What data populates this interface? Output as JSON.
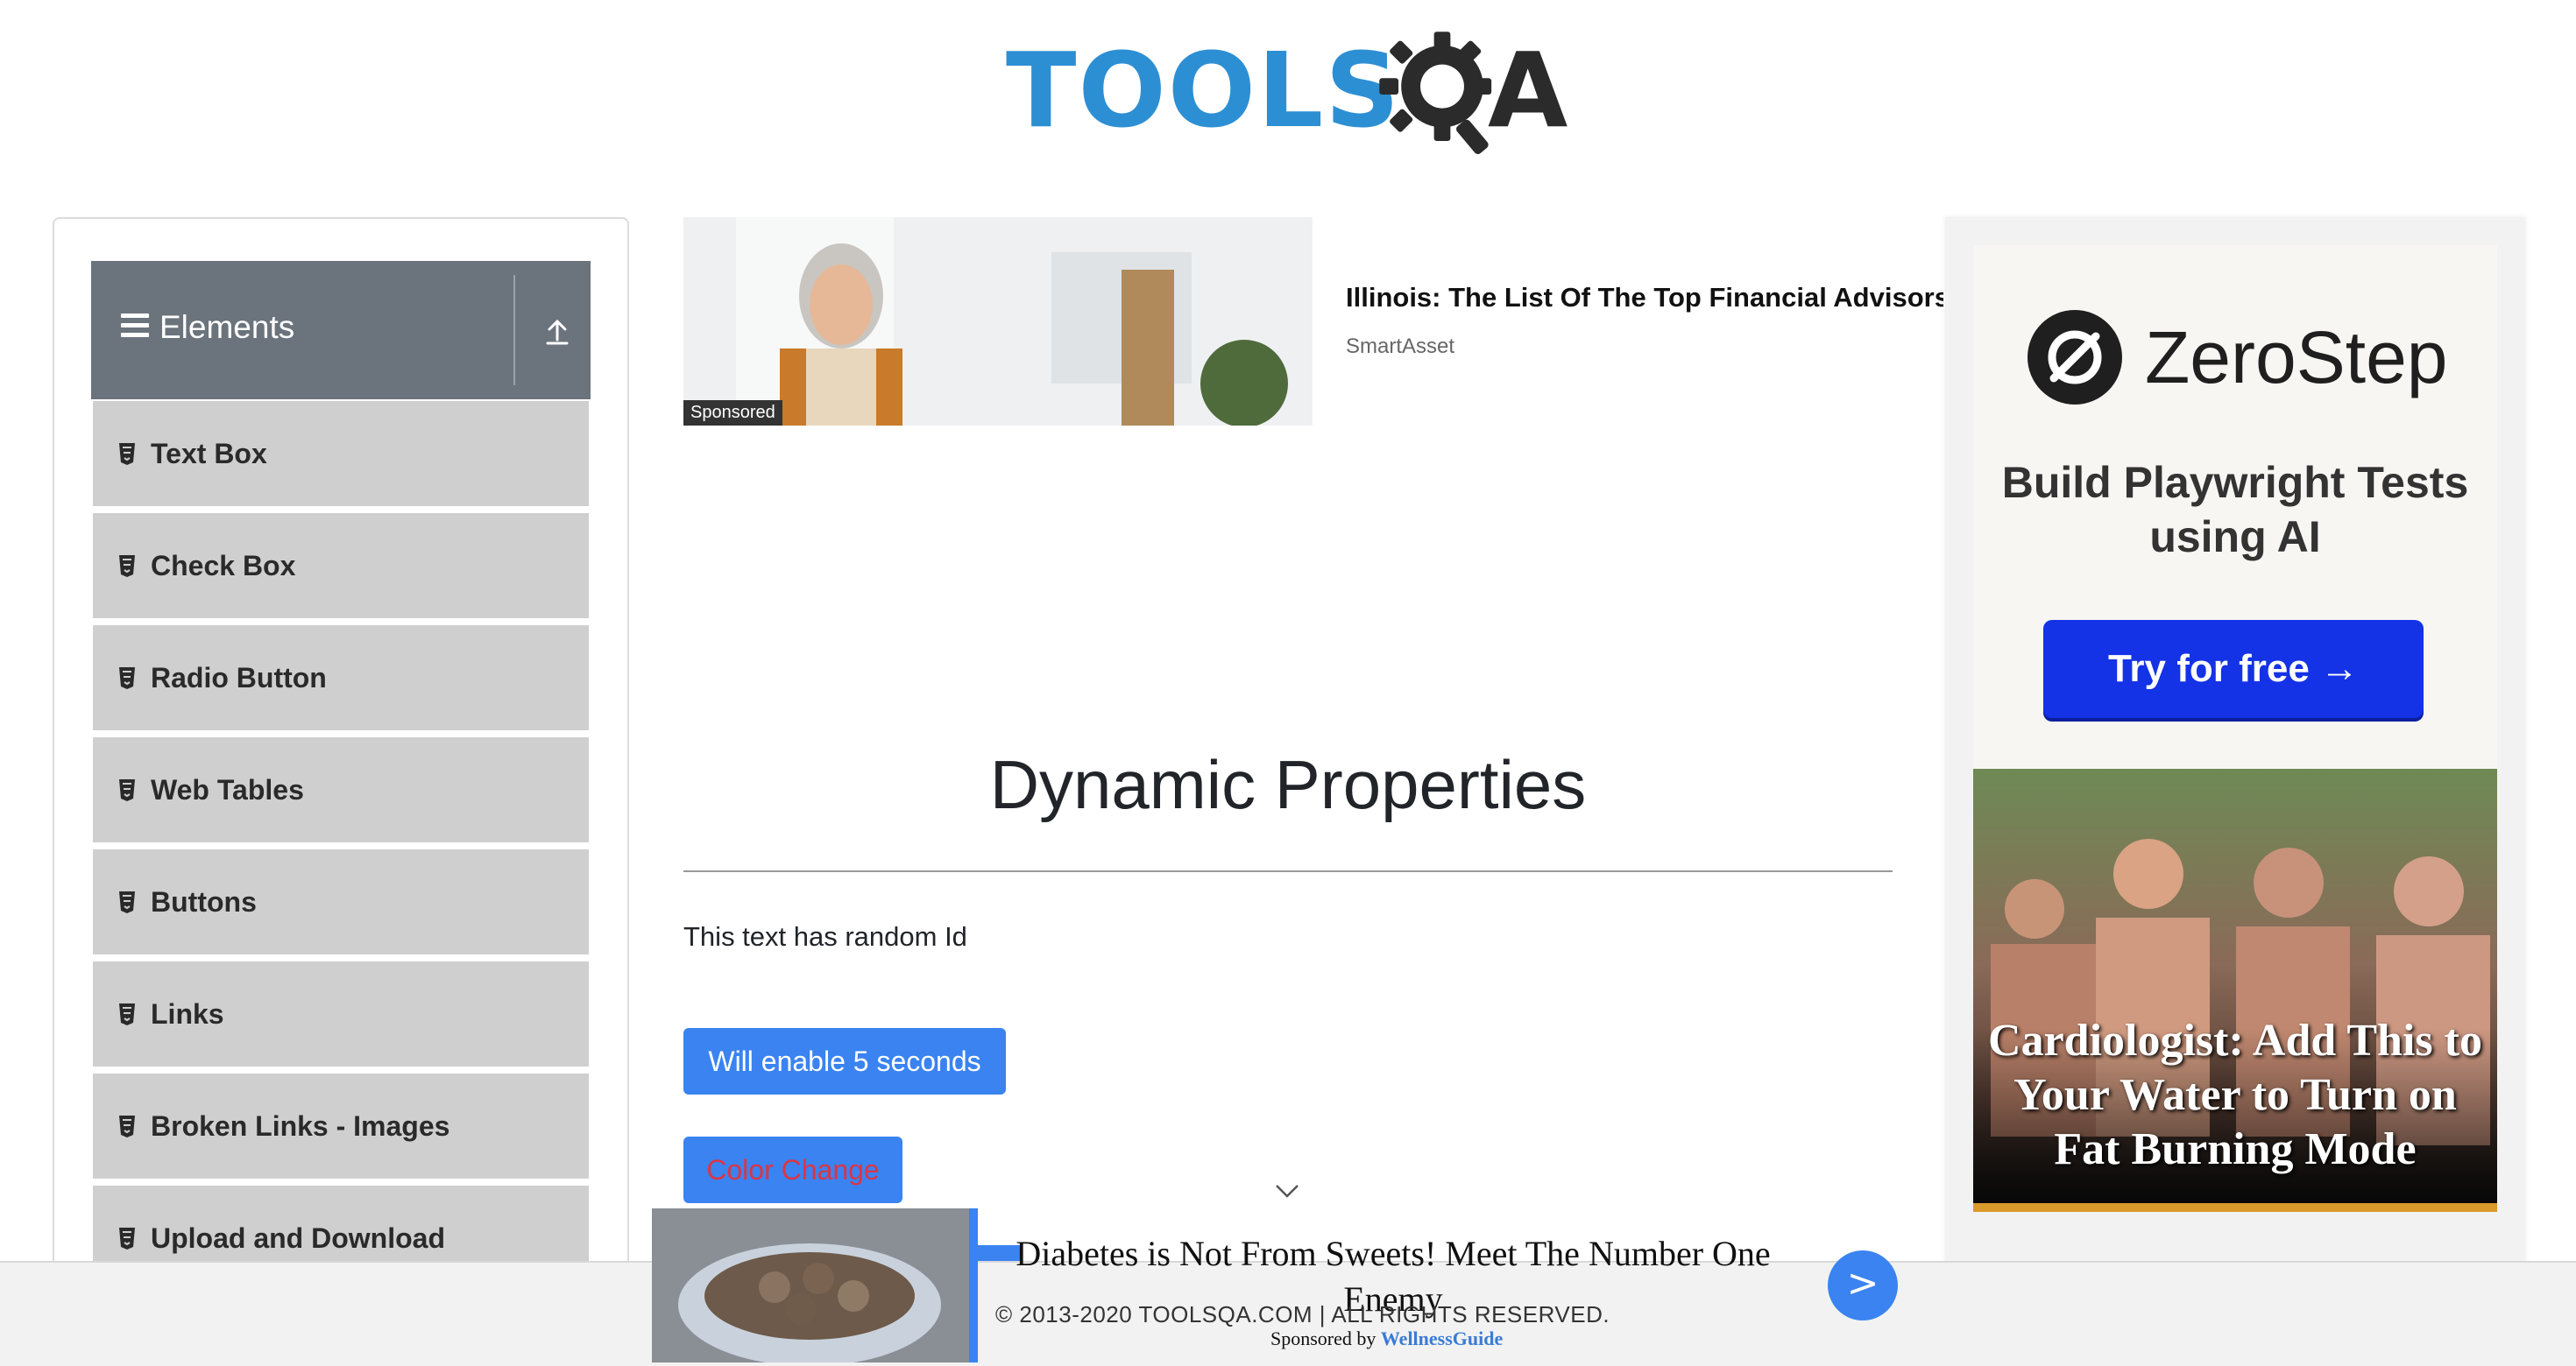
{
  "header": {
    "logo_text_left": "TOOLS",
    "logo_text_right": "A",
    "logo_color": "#2d8fd3"
  },
  "sidebar": {
    "group_title": "Elements",
    "group_icon": "hamburger-icon",
    "collapse_icon": "upload-arrow-icon",
    "items": [
      {
        "label": "Text Box"
      },
      {
        "label": "Check Box"
      },
      {
        "label": "Radio Button"
      },
      {
        "label": "Web Tables"
      },
      {
        "label": "Buttons"
      },
      {
        "label": "Links"
      },
      {
        "label": "Broken Links - Images"
      },
      {
        "label": "Upload and Download"
      }
    ]
  },
  "top_ad": {
    "badge": "Sponsored",
    "title": "Illinois: The List Of The Top Financial Advisors",
    "source": "SmartAsset"
  },
  "main": {
    "title": "Dynamic Properties",
    "random_id_text": "This text has random Id",
    "enable_button": "Will enable 5 seconds",
    "color_change_button": "Color Change",
    "color_change_text_color": "#dc3545",
    "button_color": "#3a83f1"
  },
  "right_ad": {
    "brand": "ZeroStep",
    "tagline": "Build Playwright Tests using AI",
    "cta": "Try for free →",
    "cta_color": "#1432e6",
    "headline": "Cardiologist: Add This to Your Water to Turn on Fat Burning Mode"
  },
  "bottom_ad": {
    "title": "Diabetes is Not From Sweets! Meet The Number One Enemy",
    "next": ">",
    "sponsored_by_prefix": "Sponsored by",
    "sponsor": "WellnessGuide"
  },
  "footer": {
    "copyright": "© 2013-2020 TOOLSQA.COM | ALL RIGHTS RESERVED."
  }
}
